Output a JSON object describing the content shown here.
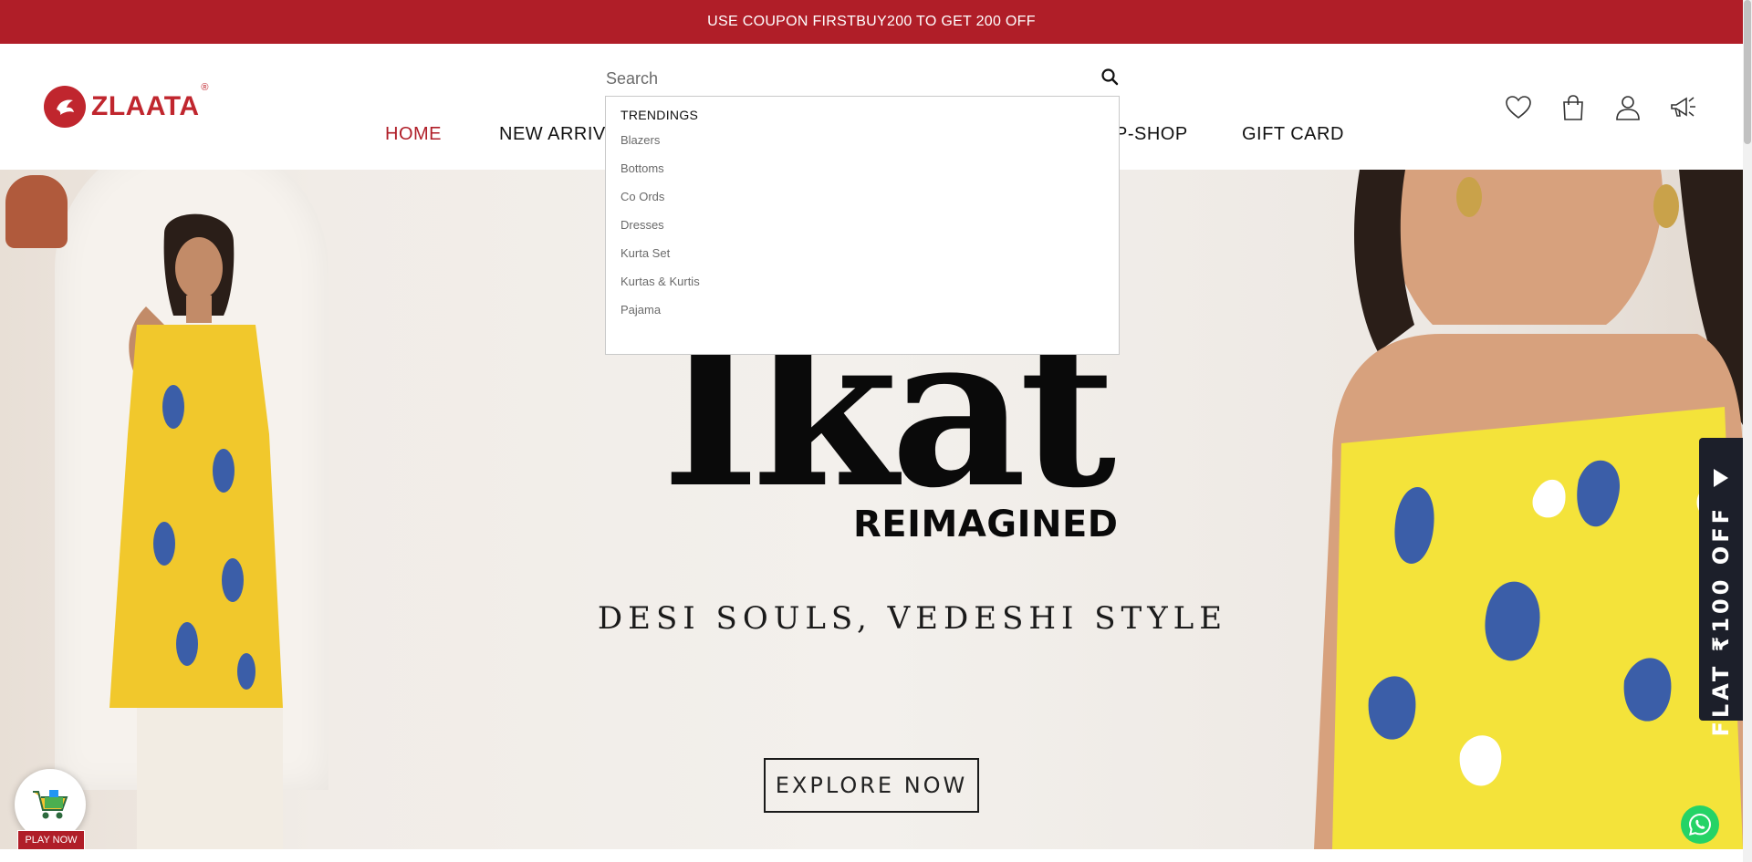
{
  "announcement": {
    "text": "USE COUPON FIRSTBUY200 TO GET 200 OFF"
  },
  "brand": {
    "name": "ZLAATA",
    "reg": "®"
  },
  "search": {
    "placeholder": "Search",
    "dropdown": {
      "title": "TRENDINGS",
      "items": [
        "Blazers",
        "Bottoms",
        "Co Ords",
        "Dresses",
        "Kurta Set",
        "Kurtas & Kurtis",
        "Pajama"
      ]
    }
  },
  "nav": {
    "items": [
      {
        "label": "HOME",
        "active": true
      },
      {
        "label": "NEW ARRIV",
        "active": false
      },
      {
        "label": "P-SHOP",
        "active": false
      },
      {
        "label": "GIFT CARD",
        "active": false
      }
    ]
  },
  "header_icons": [
    "heart-icon",
    "shopping-bag-icon",
    "user-icon",
    "megaphone-icon"
  ],
  "hero": {
    "word": "Ikat",
    "reimagined": "REIMAGINED",
    "tagline": "DESI SOULS, VEDESHI STYLE",
    "cta": "EXPLORE NOW"
  },
  "side_tab": {
    "text": "FLAT ₹100 OFF"
  },
  "game_widget": {
    "label": "PLAY NOW"
  },
  "colors": {
    "brand_red": "#b01e28",
    "side_tab_bg": "#1c1f2a",
    "whatsapp": "#25d366"
  }
}
